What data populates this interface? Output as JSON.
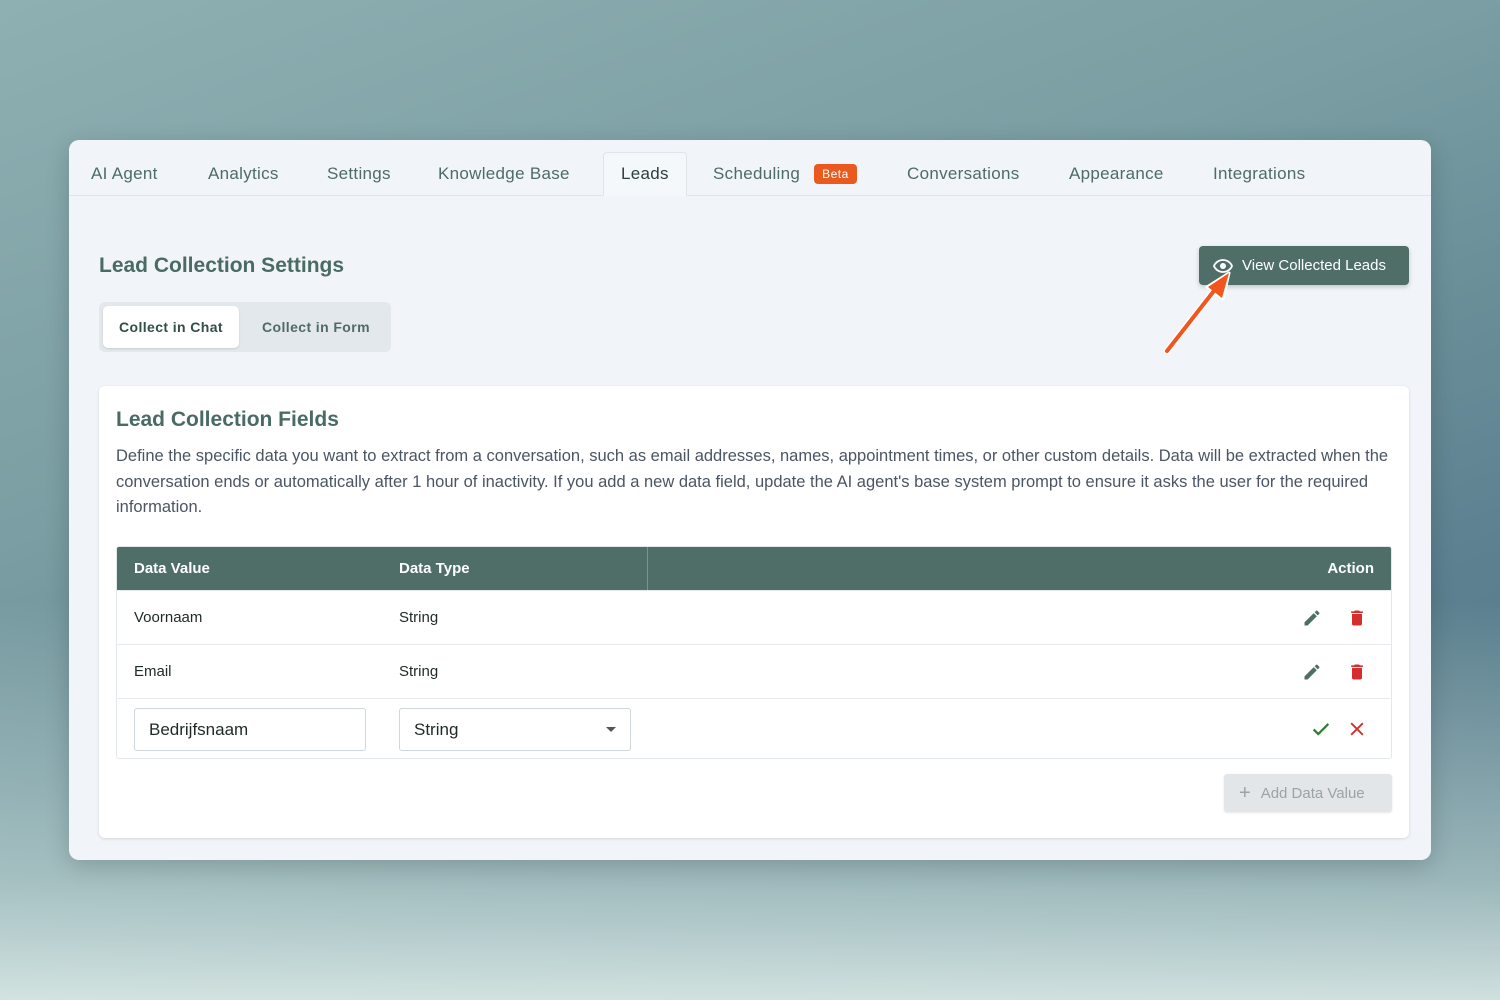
{
  "tabs": [
    {
      "label": "AI Agent"
    },
    {
      "label": "Analytics"
    },
    {
      "label": "Settings"
    },
    {
      "label": "Knowledge Base"
    },
    {
      "label": "Leads",
      "active": true
    },
    {
      "label": "Scheduling",
      "badge": "Beta"
    },
    {
      "label": "Conversations"
    },
    {
      "label": "Appearance"
    },
    {
      "label": "Integrations"
    }
  ],
  "settings": {
    "title": "Lead Collection Settings",
    "toggle": [
      "Collect in Chat",
      "Collect in Form"
    ],
    "view_button": "View Collected Leads"
  },
  "fields_card": {
    "title": "Lead Collection Fields",
    "description": "Define the specific data you want to extract from a conversation, such as email addresses, names, appointment times, or other custom details. Data will be extracted when the conversation ends or automatically after 1 hour of inactivity. If you add a new data field, update the AI agent's base system prompt to ensure it asks the user for the required information.",
    "headers": {
      "value": "Data Value",
      "type": "Data Type",
      "action": "Action"
    },
    "rows": [
      {
        "value": "Voornaam",
        "type": "String"
      },
      {
        "value": "Email",
        "type": "String"
      }
    ],
    "edit_row": {
      "value": "Bedrijfsnaam",
      "type": "String"
    },
    "add_button": "Add Data Value"
  },
  "colors": {
    "accent": "#4f6e68",
    "beta_badge": "#ea5a1e",
    "delete": "#d32f2f",
    "confirm": "#2e7d32",
    "arrow": "#f0561e"
  },
  "icons": [
    "eye-icon",
    "pencil-icon",
    "trash-icon",
    "check-icon",
    "close-icon",
    "plus-icon",
    "chevron-down-icon"
  ]
}
